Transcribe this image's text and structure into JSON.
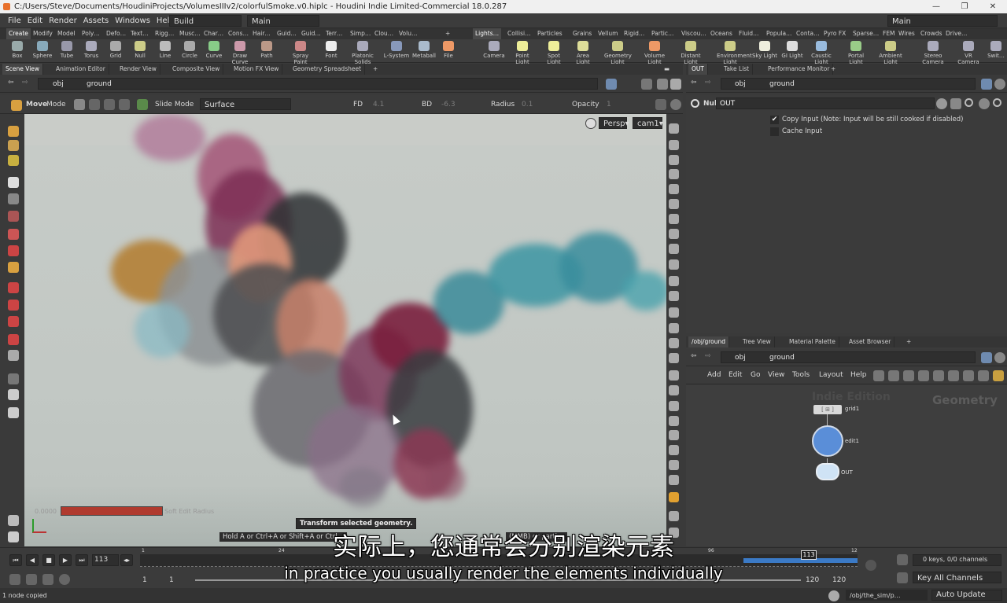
{
  "window": {
    "title": "C:/Users/Steve/Documents/HoudiniProjects/VolumesIIIv2/colorfulSmoke.v0.hiplc - Houdini Indie Limited-Commercial 18.0.287"
  },
  "menu": {
    "items": [
      "File",
      "Edit",
      "Render",
      "Assets",
      "Windows",
      "Help"
    ],
    "desktop": "Build",
    "context": "Main",
    "right_context": "Main"
  },
  "shelf_tabs_left": [
    "Create",
    "Modify",
    "Model",
    "Poly…",
    "Defo…",
    "Text…",
    "Rigg…",
    "Musc…",
    "Char…",
    "Cons…",
    "Hair…",
    "Guid…",
    "Guid…",
    "Terr…",
    "Simp…",
    "Clou…",
    "Volu…"
  ],
  "shelf_tabs_right": [
    "Lights…",
    "Collisi…",
    "Particles",
    "Grains",
    "Vellum",
    "Rigid…",
    "Partic…",
    "Viscou…",
    "Oceans",
    "Fluid…",
    "Popula…",
    "Conta…",
    "Pyro FX",
    "Sparse…",
    "FEM",
    "Wires",
    "Crowds",
    "Drive…"
  ],
  "tools_left": [
    "Box",
    "Sphere",
    "Tube",
    "Torus",
    "Grid",
    "Null",
    "Line",
    "Circle",
    "Curve",
    "Draw Curve",
    "Path",
    "Spray Paint",
    "Font",
    "Platonic Solids",
    "L-System",
    "Metaball",
    "File"
  ],
  "tools_right": [
    "Camera",
    "Point Light",
    "Spot Light",
    "Area Light",
    "Geometry Light",
    "Volume Light",
    "Distant Light",
    "Environment Light",
    "Sky Light",
    "GI Light",
    "Caustic Light",
    "Portal Light",
    "Ambient Light",
    "Stereo Camera",
    "VR Camera",
    "Swit…"
  ],
  "pane_tabs_left": [
    "Scene View",
    "Animation Editor",
    "Render View",
    "Composite View",
    "Motion FX View",
    "Geometry Spreadsheet"
  ],
  "pane_tabs_right": [
    "OUT",
    "Take List",
    "Performance Monitor"
  ],
  "path": {
    "root": "obj",
    "node": "ground"
  },
  "opbar": {
    "tool": "Move",
    "mode_label": "Mode",
    "slide_mode": "Slide Mode",
    "surface": "Surface",
    "fd_label": "FD",
    "fd_value": "4.1",
    "bd_label": "BD",
    "bd_value": "-6.3",
    "radius_label": "Radius",
    "radius_value": "0.1",
    "opacity_label": "Opacity",
    "opacity_value": "1"
  },
  "viewport": {
    "persp": "Persp▾",
    "cam": "cam1▾",
    "soft_value": "0.0000",
    "soft_label": "Soft Edit Radius",
    "tooltip": "Transform selected geometry.",
    "hint": "Hold A or Ctrl+A or Shift+A or Ctrl…",
    "hint2": "(MMB) or parti…"
  },
  "params": {
    "type": "Null",
    "name": "OUT",
    "copy_input": "Copy Input (Note: Input will be still cooked if disabled)",
    "cache_input": "Cache Input"
  },
  "network": {
    "tabs": [
      "/obj/ground",
      "Tree View",
      "Material Palette",
      "Asset Browser"
    ],
    "menu": [
      "Add",
      "Edit",
      "Go",
      "View",
      "Tools",
      "Layout",
      "Help"
    ],
    "watermark1": "Indie Edition",
    "watermark2": "Geometry",
    "nodes": [
      "grid1",
      "edit1",
      "OUT"
    ]
  },
  "timeline": {
    "frame": "113",
    "start": "1",
    "start2": "1",
    "end": "120",
    "end2": "120",
    "ticks": [
      "1",
      "24",
      "96",
      "12"
    ],
    "current_marker": "113",
    "keys": "0 keys, 0/0 channels",
    "key_all": "Key All Channels",
    "auto_update": "Auto Update"
  },
  "status": {
    "left": "1 node copied",
    "right": "/obj/the_sim/p…"
  },
  "subtitles": {
    "zh": "实际上，您通常会分别渲染元素",
    "en": "in practice you usually render the elements individually"
  }
}
